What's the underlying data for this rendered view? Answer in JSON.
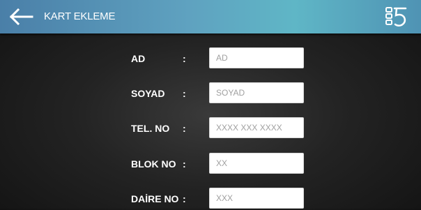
{
  "header": {
    "title": "KART EKLEME",
    "back_icon": "arrow-left-icon",
    "brand_icon": "building-logo-icon"
  },
  "form": {
    "rows": [
      {
        "label": "AD",
        "colon": ":",
        "placeholder": "AD"
      },
      {
        "label": "SOYAD",
        "colon": ":",
        "placeholder": "SOYAD"
      },
      {
        "label": "TEL. NO",
        "colon": ":",
        "placeholder": "XXXX XXX XXXX"
      },
      {
        "label": "BLOK NO",
        "colon": ":",
        "placeholder": "XX"
      },
      {
        "label": "DAİRE NO",
        "colon": ":",
        "placeholder": "XXX"
      }
    ]
  }
}
